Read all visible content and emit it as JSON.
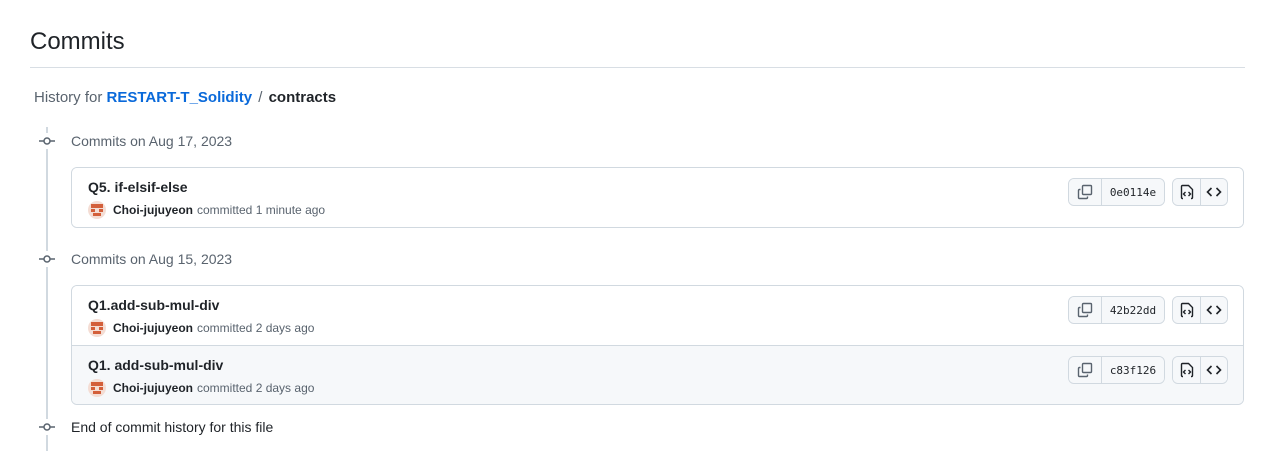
{
  "page": {
    "title": "Commits"
  },
  "breadcrumb": {
    "prefix": "History for",
    "repo": "RESTART-T_Solidity",
    "separator": "/",
    "path": "contracts"
  },
  "groups": [
    {
      "label": "Commits on Aug 17, 2023",
      "commits": [
        {
          "message": "Q5. if-elsif-else",
          "author": "Choi-jujuyeon",
          "action": "committed",
          "time": "1 minute ago",
          "sha": "0e0114e"
        }
      ]
    },
    {
      "label": "Commits on Aug 15, 2023",
      "commits": [
        {
          "message": "Q1.add-sub-mul-div",
          "author": "Choi-jujuyeon",
          "action": "committed",
          "time": "2 days ago",
          "sha": "42b22dd"
        },
        {
          "message": "Q1. add-sub-mul-div",
          "author": "Choi-jujuyeon",
          "action": "committed",
          "time": "2 days ago",
          "sha": "c83f126"
        }
      ]
    }
  ],
  "end_label": "End of commit history for this file",
  "icons": {
    "timeline_node": "git-commit-icon",
    "copy": "copy-icon",
    "view_file": "file-code-icon",
    "browse": "code-icon",
    "avatar": "identicon-avatar"
  },
  "colors": {
    "link": "#0969da",
    "text": "#1f2328",
    "muted": "#59636e",
    "border": "#d1d9e0",
    "avatar_accent": "#d35f3a"
  }
}
